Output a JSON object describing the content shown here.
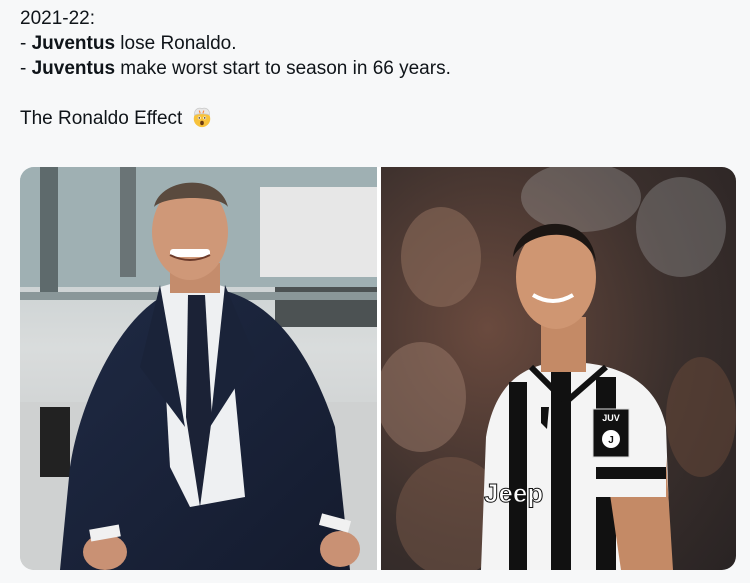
{
  "tweet": {
    "line1": "2021-22:",
    "line2_prefix": "- ",
    "line2_bold": "Juventus",
    "line2_rest": " lose Ronaldo.",
    "line3_prefix": "- ",
    "line3_bold": "Juventus",
    "line3_rest": " make worst start to season in 66 years.",
    "line4": "The Ronaldo Effect",
    "emoji": "exploding-head-emoji"
  },
  "media": {
    "left_photo": {
      "subject": "coach-in-suit-photo"
    },
    "right_photo": {
      "subject": "player-in-jersey-photo",
      "badge_text": "JUV",
      "chest_text": "Jeep"
    }
  },
  "colors": {
    "text": "#0f1419",
    "background": "#f7f8f9",
    "emoji_face": "#f7c23c"
  }
}
